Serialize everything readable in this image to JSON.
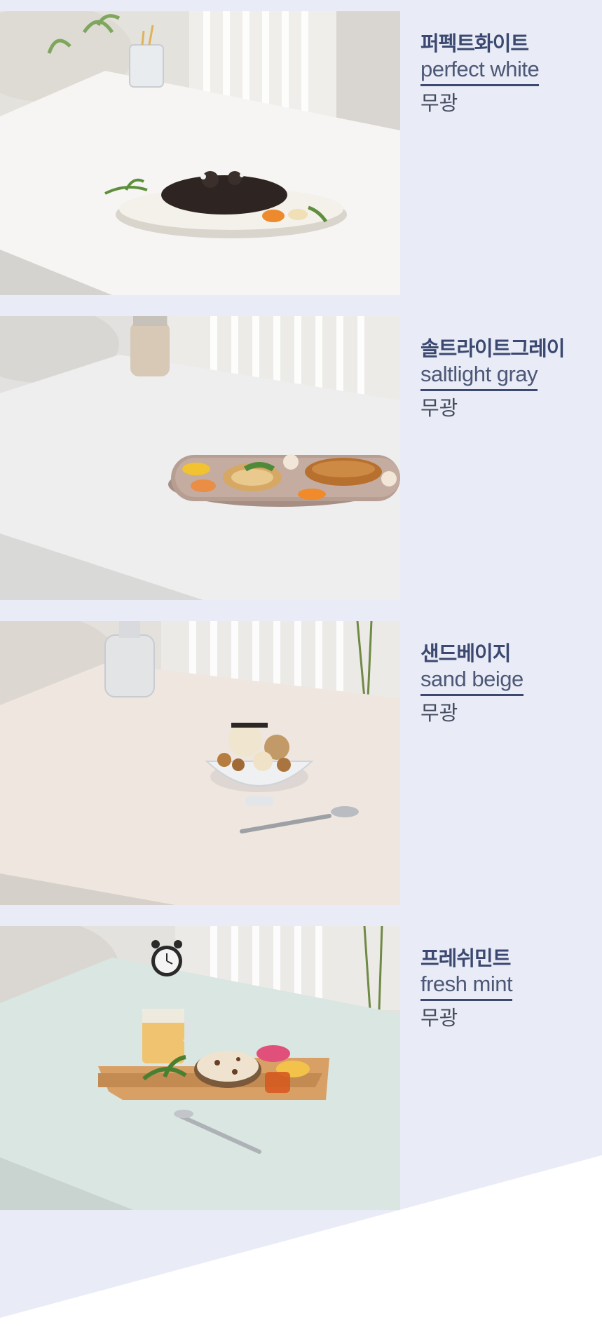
{
  "colors": {
    "page_background": "#e9ecf6",
    "label_text": "#3b4870",
    "white_wedge": "#ffffff"
  },
  "swatches": [
    {
      "name_ko": "퍼펙트화이트",
      "name_en": "perfect white",
      "finish": "무광",
      "table_color": "#f7f5f3",
      "dish": "chocolate croissant on oval tray",
      "icon": "table-photo-perfect-white"
    },
    {
      "name_ko": "솔트라이트그레이",
      "name_en": "saltlight gray",
      "finish": "무광",
      "table_color": "#eeeeee",
      "dish": "croissant and toast on brown tray",
      "icon": "table-photo-saltlight-gray"
    },
    {
      "name_ko": "샌드베이지",
      "name_en": "sand beige",
      "finish": "무광",
      "table_color": "#efe6e0",
      "dish": "nut sundae in glass bowl with spoon",
      "icon": "table-photo-sand-beige"
    },
    {
      "name_ko": "프레쉬민트",
      "name_en": "fresh mint",
      "finish": "무광",
      "table_color": "#d9e6e1",
      "dish": "bread board with macarons, juice and clock",
      "icon": "table-photo-fresh-mint"
    }
  ]
}
